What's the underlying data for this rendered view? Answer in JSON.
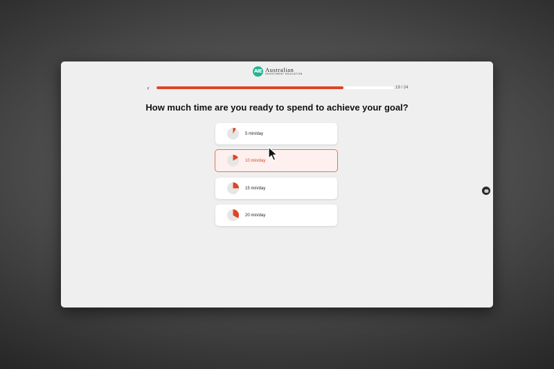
{
  "header": {
    "logo_mark": "AIE",
    "logo_line1": "Australian",
    "logo_line2": "Investment Education"
  },
  "nav": {
    "back_icon": "chevron-left-icon",
    "back_label": "‹"
  },
  "progress": {
    "current": 19,
    "total": 24,
    "label": "19 / 24",
    "fill_fraction": 0.79,
    "color": "#dc4527"
  },
  "quiz": {
    "question": "How much time are you ready to spend to achieve your goal?",
    "selected_index": 1,
    "options": [
      {
        "label": "5 min/day",
        "minutes": 5
      },
      {
        "label": "10 min/day",
        "minutes": 10
      },
      {
        "label": "15 min/day",
        "minutes": 15
      },
      {
        "label": "20 min/day",
        "minutes": 20
      }
    ]
  },
  "colors": {
    "accent": "#dc4527",
    "selected_border": "#e07258",
    "selected_bg": "#fdf0ee",
    "pie_base": "#e6e6e6",
    "logo": "#21b591"
  },
  "side_widget": {
    "icon": "assistant-icon"
  }
}
